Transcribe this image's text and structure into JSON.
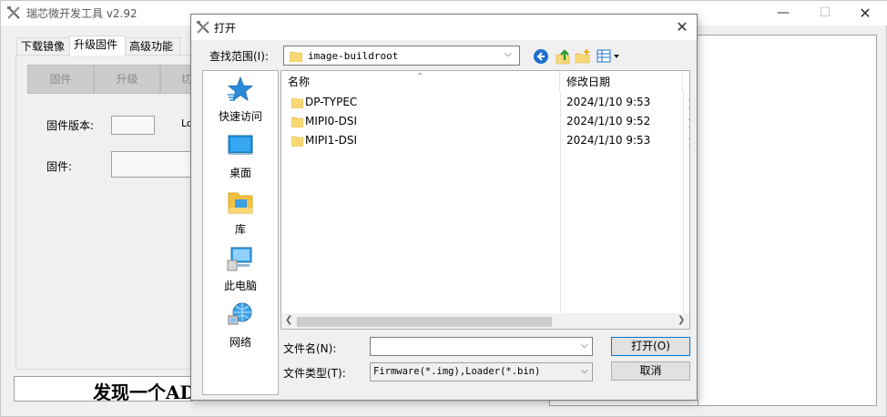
{
  "main_window": {
    "title": "瑞芯微开发工具 v2.92",
    "controls": {
      "minimize": "—",
      "maximize": "☐",
      "close": "✕"
    },
    "tabs": [
      {
        "label": "下载镜像"
      },
      {
        "label": "升级固件"
      },
      {
        "label": "高级功能"
      }
    ],
    "toolbar": {
      "firmware": "固件",
      "upgrade": "升级",
      "switch": "切"
    },
    "fields": {
      "firmware_version_label": "固件版本:",
      "loader_label": "Lo",
      "firmware_label": "固件:"
    },
    "status": "发现一个ADB设备"
  },
  "dialog": {
    "title": "打开",
    "close": "✕",
    "look_in_label": "查找范围(I):",
    "look_in_value": "image-buildroot",
    "places": [
      {
        "label": "快速访问",
        "icon": "quick-access-star-icon"
      },
      {
        "label": "桌面",
        "icon": "desktop-icon"
      },
      {
        "label": "库",
        "icon": "library-icon"
      },
      {
        "label": "此电脑",
        "icon": "this-pc-icon"
      },
      {
        "label": "网络",
        "icon": "network-icon"
      }
    ],
    "columns": {
      "name": "名称",
      "date": "修改日期",
      "type": "类"
    },
    "files": [
      {
        "name": "DP-TYPEC",
        "date": "2024/1/10 9:53",
        "type": "文"
      },
      {
        "name": "MIPI0-DSI",
        "date": "2024/1/10 9:52",
        "type": "文"
      },
      {
        "name": "MIPI1-DSI",
        "date": "2024/1/10 9:53",
        "type": "文"
      }
    ],
    "file_name_label": "文件名(N):",
    "file_name_value": "",
    "file_type_label": "文件类型(T):",
    "file_type_value": "Firmware(*.img),Loader(*.bin)",
    "open_button": "打开(O)",
    "cancel_button": "取消",
    "colors": {
      "folder": "#f8d775",
      "accent": "#0078d7"
    }
  }
}
